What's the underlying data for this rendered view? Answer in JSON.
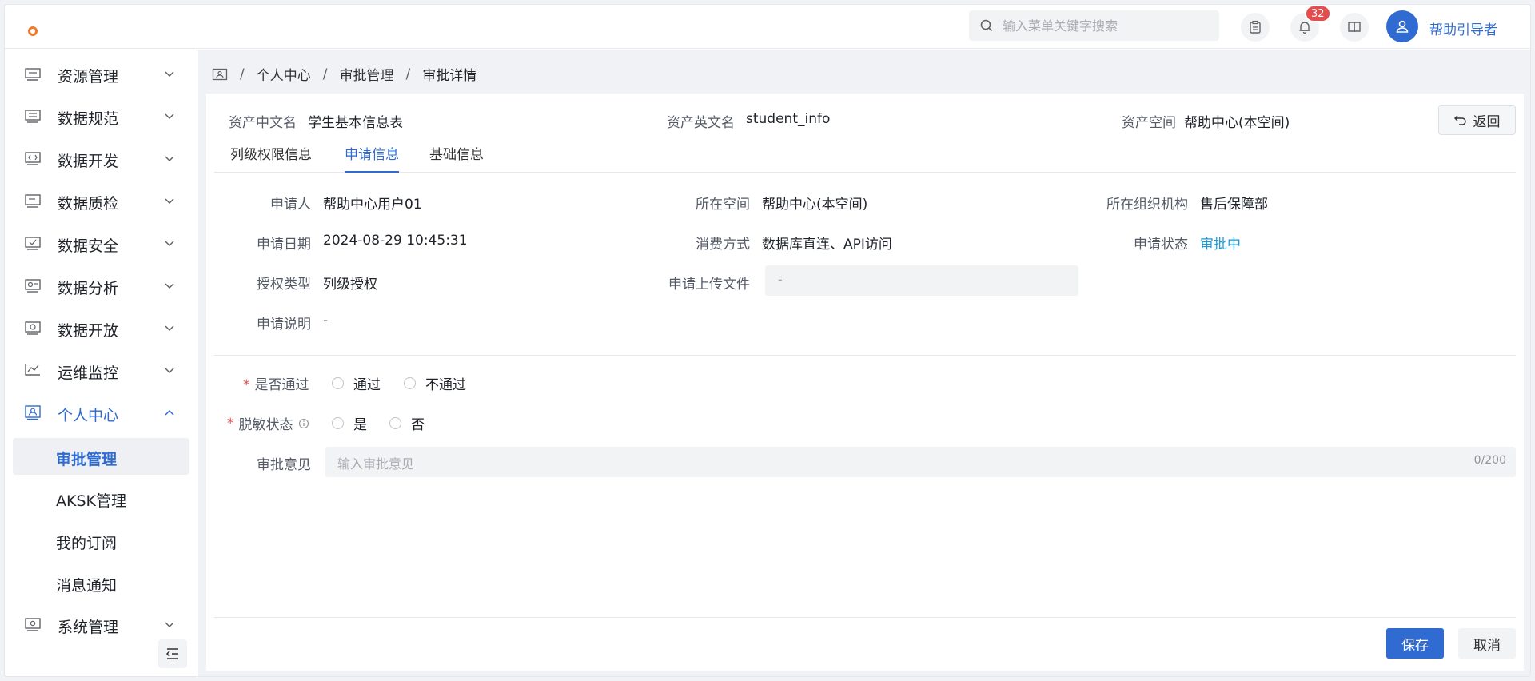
{
  "header": {
    "search_placeholder": "输入菜单关键字搜索",
    "notification_count": "32",
    "username": "帮助引导者",
    "accent_color": "#2f6bd0"
  },
  "sidebar": {
    "items": [
      {
        "label": "资源管理",
        "icon": "resource-icon"
      },
      {
        "label": "数据规范",
        "icon": "data-standard-icon"
      },
      {
        "label": "数据开发",
        "icon": "code-icon"
      },
      {
        "label": "数据质检",
        "icon": "quality-icon"
      },
      {
        "label": "数据安全",
        "icon": "security-icon"
      },
      {
        "label": "数据分析",
        "icon": "analysis-icon"
      },
      {
        "label": "数据开放",
        "icon": "open-data-icon"
      },
      {
        "label": "运维监控",
        "icon": "monitor-icon"
      },
      {
        "label": "个人中心",
        "icon": "personal-icon"
      }
    ],
    "sub_items": [
      "审批管理",
      "AKSK管理",
      "我的订阅",
      "消息通知"
    ],
    "system": {
      "label": "系统管理",
      "icon": "system-icon"
    }
  },
  "breadcrumb": [
    "个人中心",
    "审批管理",
    "审批详情"
  ],
  "asset": {
    "cn_name_label": "资产中文名",
    "cn_name": "学生基本信息表",
    "en_name_label": "资产英文名",
    "en_name": "student_info",
    "space_label": "资产空间",
    "space": "帮助中心(本空间)",
    "back_label": "返回"
  },
  "tabs": [
    "列级权限信息",
    "申请信息",
    "基础信息"
  ],
  "application": {
    "applicant_label": "申请人",
    "applicant": "帮助中心用户01",
    "space_label": "所在空间",
    "space": "帮助中心(本空间)",
    "org_label": "所在组织机构",
    "org": "售后保障部",
    "date_label": "申请日期",
    "date": "2024-08-29 10:45:31",
    "consume_label": "消费方式",
    "consume": "数据库直连、API访问",
    "status_label": "申请状态",
    "status": "审批中",
    "auth_label": "授权类型",
    "auth": "列级授权",
    "upload_label": "申请上传文件",
    "upload": "-",
    "desc_label": "申请说明",
    "desc": "-"
  },
  "approval": {
    "pass_label": "是否通过",
    "pass_options": [
      "通过",
      "不通过"
    ],
    "mask_label": "脱敏状态",
    "mask_options": [
      "是",
      "否"
    ],
    "opinion_label": "审批意见",
    "opinion_placeholder": "输入审批意见",
    "opinion_counter": "0/200"
  },
  "actions": {
    "save": "保存",
    "cancel": "取消"
  }
}
